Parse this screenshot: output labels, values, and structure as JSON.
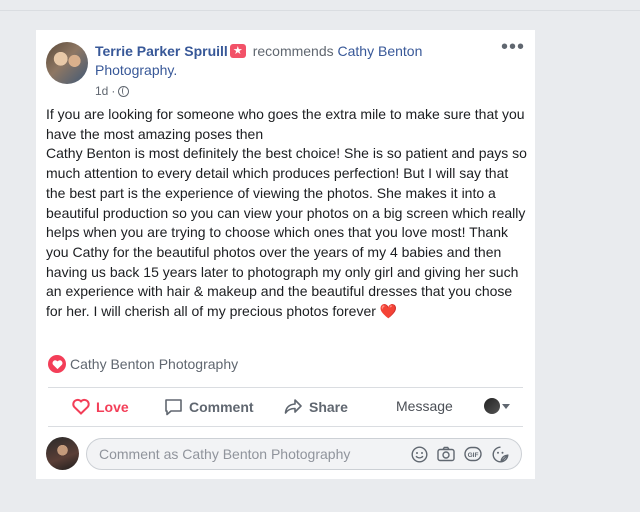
{
  "post": {
    "author": "Terrie Parker Spruill",
    "verb": "recommends",
    "page_name": "Cathy Benton Photography.",
    "time": "1d",
    "more_label": "•••",
    "paragraph1": "If you are looking for someone who goes the extra mile to make sure that you have the most amazing poses then",
    "paragraph2": "Cathy Benton is most definitely the best choice! She is so patient and pays so much attention to every detail which produces perfection! But I will say that the best part is the experience of viewing the photos. She makes it into a beautiful production so you can view your photos on a big screen which really helps when you are trying to choose which ones that you love most! Thank you Cathy for the beautiful photos over the years of my 4 babies and then having us back 15 years later to photograph my only girl and giving her such an experience with hair & makeup and the beautiful dresses that you chose for her. I will cherish all of my precious photos forever",
    "emoji": "❤️"
  },
  "reactions": {
    "names": "Cathy Benton Photography"
  },
  "actions": {
    "love": "Love",
    "comment": "Comment",
    "share": "Share",
    "message": "Message"
  },
  "comment_input": {
    "placeholder": "Comment as Cathy Benton Photography"
  },
  "colors": {
    "link": "#385898",
    "love": "#f33e58",
    "background": "#e9ebee"
  }
}
